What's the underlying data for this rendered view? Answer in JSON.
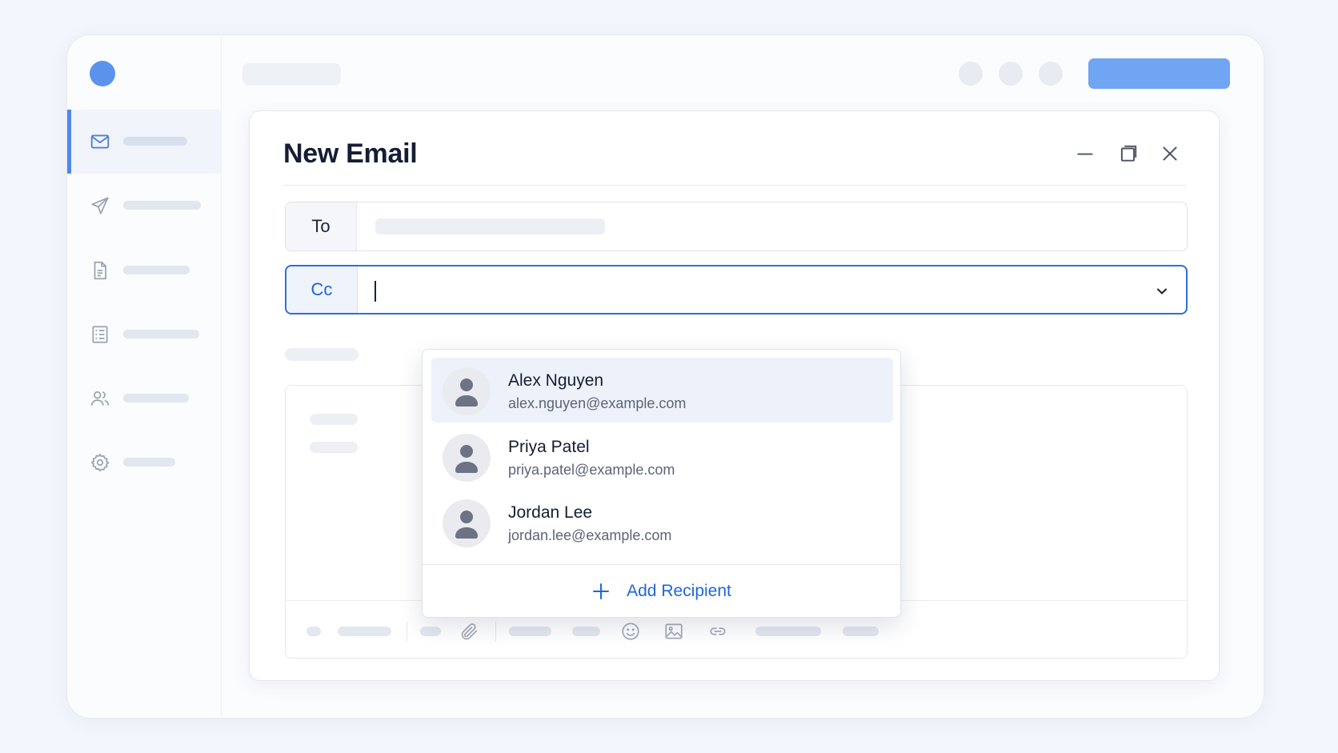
{
  "compose": {
    "title": "New Email",
    "to_label": "To",
    "cc_label": "Cc",
    "window_controls": [
      "minimize-icon",
      "maximize-icon",
      "close-icon"
    ]
  },
  "suggestions": [
    {
      "name": "Alex Nguyen",
      "email": "alex.nguyen@example.com",
      "highlighted": true
    },
    {
      "name": "Priya Patel",
      "email": "priya.patel@example.com",
      "highlighted": false
    },
    {
      "name": "Jordan Lee",
      "email": "jordan.lee@example.com",
      "highlighted": false
    }
  ],
  "add_recipient": {
    "label": "Add Recipient",
    "icon": "plus-icon"
  },
  "sidebar": {
    "icons": [
      "mail-icon",
      "send-icon",
      "document-icon",
      "list-icon",
      "users-icon",
      "settings-icon"
    ]
  },
  "toolbar": {
    "icons": [
      "attachment-icon",
      "emoji-icon",
      "image-icon",
      "link-icon"
    ]
  },
  "colors": {
    "accent": "#1e66dc",
    "primary_button": "#6fa5f2",
    "logo": "#5b93ec",
    "title_text": "#141d33"
  }
}
